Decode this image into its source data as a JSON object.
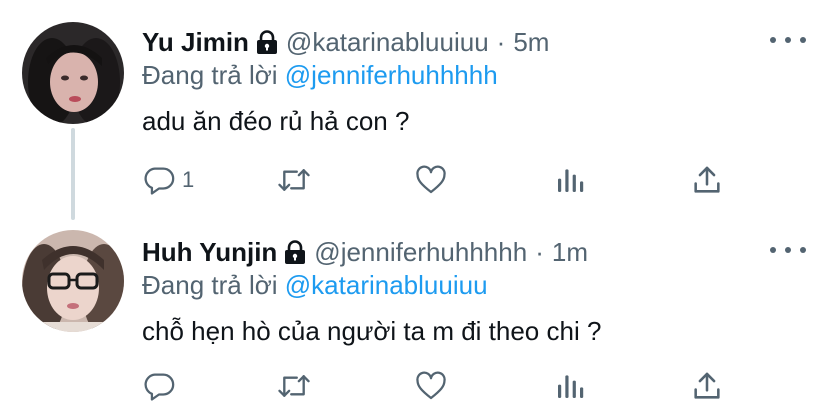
{
  "tweets": [
    {
      "name": "Yu Jimin",
      "handle": "@katarinabluuiuu",
      "dot": "·",
      "time": "5m",
      "replying_prefix": "Đang trả lời ",
      "replying_to": "@jenniferhuhhhhh",
      "text": "adu ăn đéo rủ hả con ?",
      "reply_count": "1",
      "retweet_count": "",
      "like_count": ""
    },
    {
      "name": "Huh Yunjin",
      "handle": "@jenniferhuhhhhh",
      "dot": "·",
      "time": "1m",
      "replying_prefix": "Đang trả lời ",
      "replying_to": "@katarinabluuiuu",
      "text": "chỗ hẹn hò của người ta m đi theo chi ?",
      "reply_count": "",
      "retweet_count": "",
      "like_count": ""
    }
  ],
  "icons": {
    "more": "more-icon",
    "lock": "lock-icon",
    "reply": "reply-icon",
    "retweet": "retweet-icon",
    "like": "heart-icon",
    "stats": "stats-icon",
    "share": "share-icon"
  },
  "colors": {
    "text": "#0f1419",
    "secondary": "#536471",
    "mention": "#1d9bf0",
    "thread_line": "#cfd9de"
  }
}
